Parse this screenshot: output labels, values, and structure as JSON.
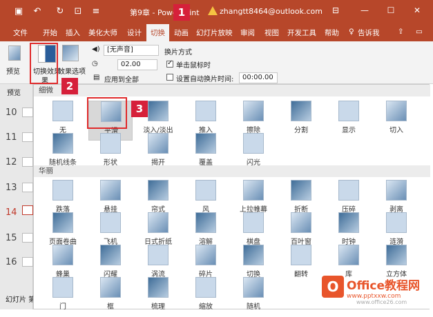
{
  "title_bar": {
    "doc_title": "第9章 - PowerPoint",
    "user_email": "zhangtt8464@outlook.com",
    "qat_icons": [
      "save-icon",
      "undo-icon",
      "redo-icon",
      "start-icon",
      "customize-icon"
    ]
  },
  "tabs": [
    "文件",
    "开始",
    "插入",
    "美化大师",
    "设计",
    "切换",
    "动画",
    "幻灯片放映",
    "审阅",
    "视图",
    "开发工具",
    "帮助",
    "告诉我"
  ],
  "active_tab": "切换",
  "ribbon": {
    "preview": "预览",
    "effect_label": "切换效果",
    "effect_label2": "果",
    "effect_options": "效果选项",
    "sound": "[无声音]",
    "duration": "02.00",
    "apply_all": "应用到全部",
    "advance_title": "换片方式",
    "on_click": "单击鼠标时",
    "after_time": "设置自动换片时间:",
    "time_value": "00:00.00"
  },
  "side_panel": {
    "header": "预览",
    "slides": [
      "10",
      "11",
      "12",
      "13",
      "14",
      "15",
      "16"
    ],
    "status": "幻灯片 第"
  },
  "gallery": {
    "section1": "细微",
    "section2": "华丽",
    "subtle": [
      "无",
      "平滑",
      "淡入/淡出",
      "推入",
      "擦除",
      "分割",
      "显示",
      "切入",
      "随机线条",
      "形状",
      "揭开",
      "覆盖",
      "闪光"
    ],
    "exciting": [
      "跌落",
      "悬挂",
      "帘式",
      "风",
      "上拉帷幕",
      "折断",
      "压碎",
      "剥离",
      "页面卷曲",
      "飞机",
      "日式折纸",
      "溶解",
      "棋盘",
      "百叶窗",
      "时钟",
      "涟漪",
      "蜂巢",
      "闪耀",
      "涡流",
      "碎片",
      "切换",
      "翻转",
      "库",
      "立方体",
      "门",
      "框",
      "梳理",
      "缩放",
      "随机"
    ]
  },
  "markers": [
    "1",
    "2",
    "3"
  ],
  "watermark": {
    "brand": "Office教程网",
    "url": "www.pptxxw.com",
    "site": "www.office26.com"
  },
  "colors": {
    "accent": "#b7472a",
    "marker": "#d6203a"
  }
}
